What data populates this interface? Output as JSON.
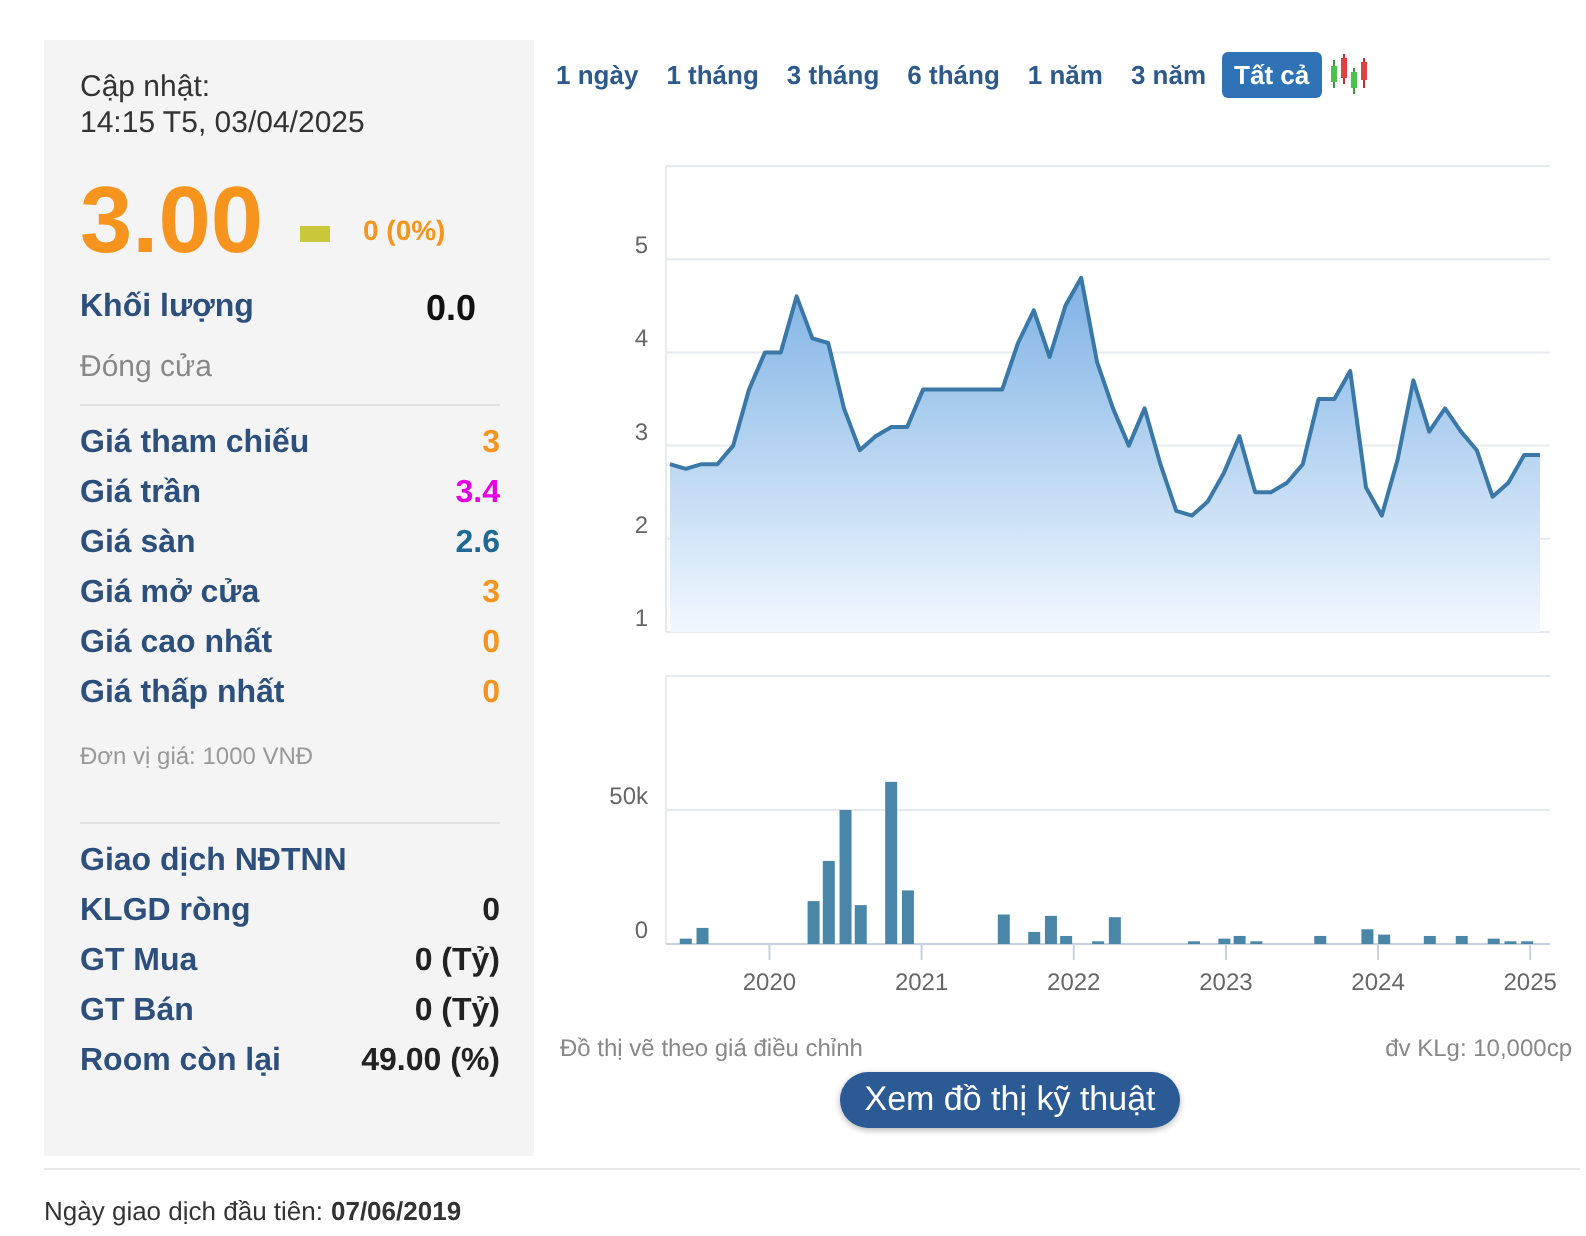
{
  "quote": {
    "updated_label": "Cập nhật:",
    "updated_time": "14:15 T5, 03/04/2025",
    "price": "3.00",
    "rising": false,
    "falling": false,
    "change": "0 (0%)",
    "volume_label": "Khối lượng",
    "volume": "0.0",
    "session_status": "Đóng cửa"
  },
  "prices": [
    {
      "label": "Giá tham chiếu",
      "value": "3",
      "color": "#f7941d"
    },
    {
      "label": "Giá trần",
      "value": "3.4",
      "color": "#e600e6"
    },
    {
      "label": "Giá sàn",
      "value": "2.6",
      "color": "#1e6a94"
    },
    {
      "label": "Giá mở cửa",
      "value": "3",
      "color": "#f7941d"
    },
    {
      "label": "Giá cao nhất",
      "value": "0",
      "color": "#f7941d"
    },
    {
      "label": "Giá thấp nhất",
      "value": "0",
      "color": "#f7941d"
    }
  ],
  "price_unit": "Đơn vị giá: 1000 VNĐ",
  "foreign": {
    "title": "Giao dịch NĐTNN",
    "rows": [
      {
        "label": "KLGD ròng",
        "value": "0"
      },
      {
        "label": "GT Mua",
        "value": "0 (Tỷ)"
      },
      {
        "label": "GT Bán",
        "value": "0 (Tỷ)"
      },
      {
        "label": "Room còn lại",
        "value": "49.00 (%)"
      }
    ]
  },
  "ranges": [
    {
      "label": "1 ngày",
      "selected": false
    },
    {
      "label": "1 tháng",
      "selected": false
    },
    {
      "label": "3 tháng",
      "selected": false
    },
    {
      "label": "6 tháng",
      "selected": false
    },
    {
      "label": "1 năm",
      "selected": false
    },
    {
      "label": "3 năm",
      "selected": false
    },
    {
      "label": "Tất cả",
      "selected": true
    }
  ],
  "price_chart": {
    "chart_data": {
      "type": "area",
      "grid": true,
      "ylim": [
        1,
        6
      ],
      "yticks": [
        1,
        2,
        3,
        4,
        5
      ],
      "values": [
        2.8,
        2.75,
        2.8,
        2.8,
        3.0,
        3.6,
        4.0,
        4.0,
        4.6,
        4.15,
        4.1,
        3.4,
        2.95,
        3.1,
        3.2,
        3.2,
        3.6,
        3.6,
        3.6,
        3.6,
        3.6,
        3.6,
        4.1,
        4.45,
        3.95,
        4.5,
        4.8,
        3.9,
        3.4,
        3.0,
        3.4,
        2.8,
        2.3,
        2.25,
        2.4,
        2.7,
        3.1,
        2.5,
        2.5,
        2.6,
        2.8,
        3.5,
        3.5,
        3.8,
        2.55,
        2.25,
        2.85,
        3.7,
        3.15,
        3.4,
        3.15,
        2.95,
        2.45,
        2.6,
        2.9,
        2.9
      ]
    }
  },
  "volume_chart": {
    "chart_data": {
      "type": "bar",
      "grid": true,
      "xlim": [
        2019.32,
        2025.13
      ],
      "ylim": [
        0,
        100000
      ],
      "xticks": [
        2020,
        2021,
        2022,
        2023,
        2024,
        2025
      ],
      "yticks": [
        0,
        {
          "value": 50000,
          "label": "50k"
        }
      ],
      "x": [
        2019.45,
        2019.56,
        2020.29,
        2020.39,
        2020.5,
        2020.6,
        2020.8,
        2020.91,
        2021.54,
        2021.74,
        2021.85,
        2021.95,
        2022.16,
        2022.27,
        2022.79,
        2022.99,
        2023.09,
        2023.2,
        2023.62,
        2023.93,
        2024.04,
        2024.34,
        2024.55,
        2024.76,
        2024.87,
        2024.98
      ],
      "values": [
        2000,
        6000,
        16000,
        31000,
        50000,
        14500,
        60500,
        20000,
        11000,
        4500,
        10500,
        3000,
        1000,
        10000,
        1000,
        2000,
        3000,
        1000,
        3000,
        5500,
        3500,
        3000,
        3000,
        2000,
        1000,
        1000
      ]
    }
  },
  "notes": {
    "left": "Đồ thị vẽ theo giá điều chỉnh",
    "right": "đv KLg: 10,000cp"
  },
  "action": "Xem đồ thị kỹ thuật",
  "first_trade": {
    "label": "Ngày giao dịch đầu tiên:",
    "date": "07/06/2019"
  }
}
